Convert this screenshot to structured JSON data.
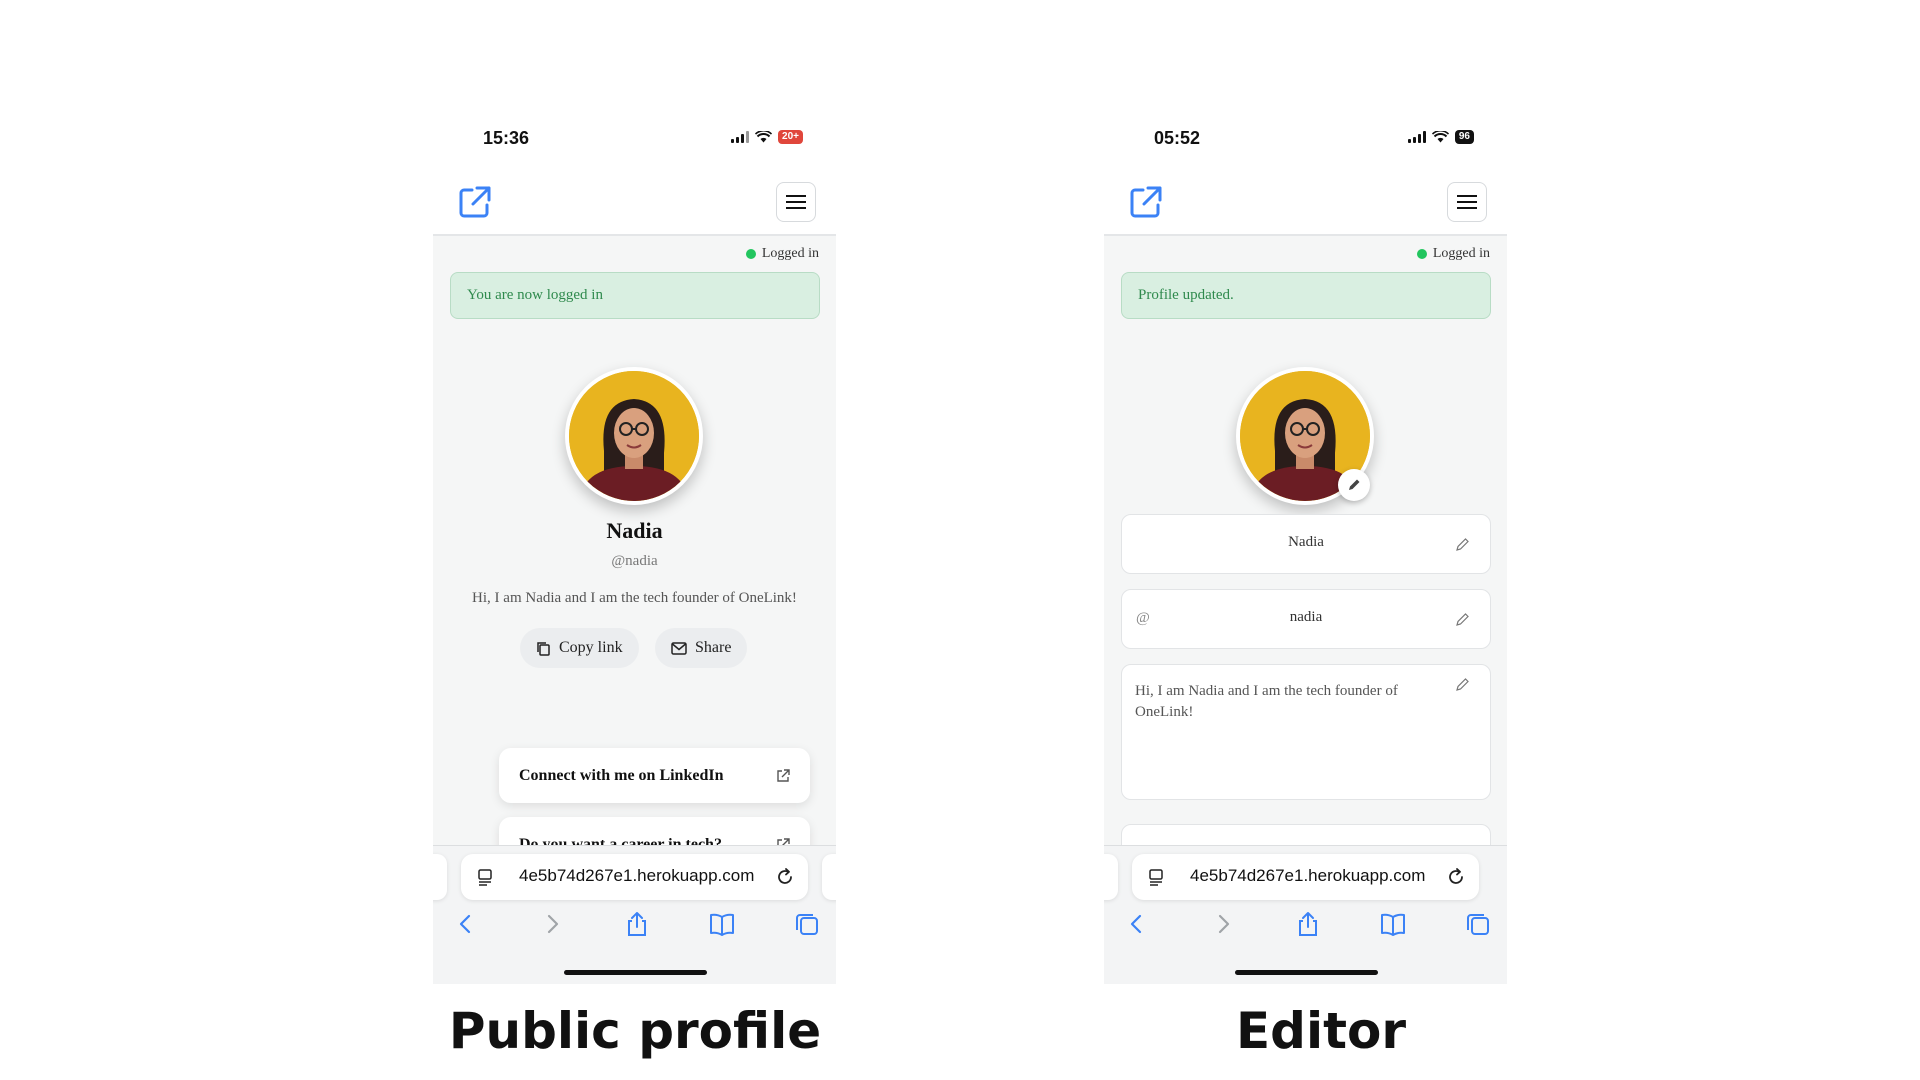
{
  "colors": {
    "accent": "#3b82f6",
    "success": "#22c55e",
    "alert_bg": "#d9efe1",
    "alert_text": "#2f8a4d"
  },
  "left_phone": {
    "status": {
      "time": "15:36",
      "battery": "20+",
      "battery_color": "#e0463b"
    },
    "logged_in": "Logged in",
    "alert": "You are now logged in",
    "profile": {
      "name": "Nadia",
      "handle": "@nadia",
      "bio": "Hi, I am Nadia and I am the tech founder of OneLink!"
    },
    "buttons": {
      "copy_link": "Copy link",
      "share": "Share"
    },
    "links": [
      "Connect with me on LinkedIn",
      "Do you want a career in tech?"
    ],
    "browser": {
      "url": "4e5b74d267e1.herokuapp.com"
    }
  },
  "right_phone": {
    "status": {
      "time": "05:52",
      "battery": "96",
      "battery_color": "#111111"
    },
    "logged_in": "Logged in",
    "alert": "Profile updated.",
    "fields": {
      "name": "Nadia",
      "at": "@",
      "username": "nadia",
      "bio": "Hi, I am Nadia and I am the tech founder of OneLink!"
    },
    "browser": {
      "url": "4e5b74d267e1.herokuapp.com"
    }
  },
  "captions": {
    "left": "Public profile",
    "right": "Editor"
  }
}
